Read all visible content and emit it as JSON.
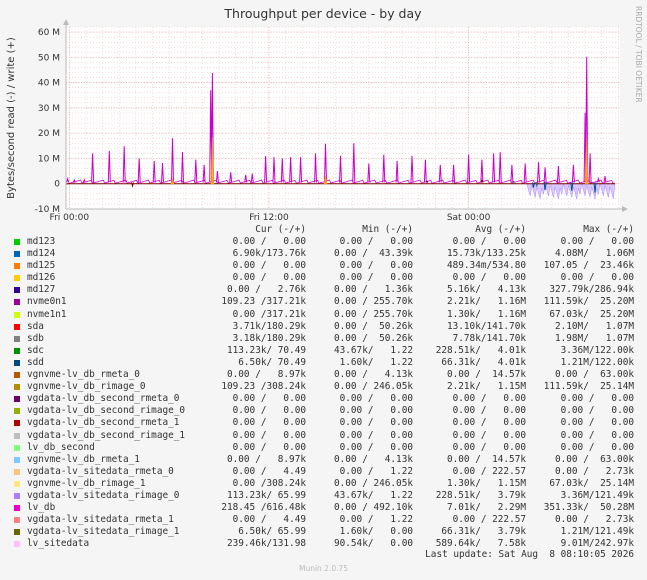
{
  "chart_data": {
    "type": "line",
    "title": "Throughput per device - by day",
    "ylabel": "Bytes/second read (-) / write (+)",
    "side_label": "RRDTOOL / TOBI OETIKER",
    "ylim": [
      -10000000,
      62000000
    ],
    "y_ticks": [
      {
        "v": -10000000,
        "label": "-10 M"
      },
      {
        "v": 0,
        "label": "0"
      },
      {
        "v": 10000000,
        "label": "10 M"
      },
      {
        "v": 20000000,
        "label": "20 M"
      },
      {
        "v": 30000000,
        "label": "30 M"
      },
      {
        "v": 40000000,
        "label": "40 M"
      },
      {
        "v": 50000000,
        "label": "50 M"
      },
      {
        "v": 60000000,
        "label": "60 M"
      }
    ],
    "x_ticks": [
      {
        "h": 0,
        "label": "Fri 00:00"
      },
      {
        "h": 12,
        "label": "Fri 12:00"
      },
      {
        "h": 24,
        "label": "Sat 00:00"
      }
    ],
    "xlim_hours": [
      -0.2,
      33.1
    ],
    "series": [
      {
        "name": "lv_db",
        "color": "#cc00cc",
        "spikes": [
          [
            -0.1,
            2.0
          ],
          [
            0.3,
            1.5
          ],
          [
            0.9,
            1.6
          ],
          [
            1.4,
            12.0
          ],
          [
            2.4,
            13.0
          ],
          [
            3.3,
            14.8
          ],
          [
            4.2,
            10.0
          ],
          [
            5.1,
            9.0
          ],
          [
            5.6,
            8.2
          ],
          [
            6.2,
            18.0
          ],
          [
            6.8,
            12.5
          ],
          [
            7.6,
            9.5
          ],
          [
            8.1,
            7.5
          ],
          [
            8.5,
            37.0
          ],
          [
            8.6,
            43.8
          ],
          [
            8.9,
            5.0
          ],
          [
            9.7,
            4.5
          ],
          [
            10.6,
            3.5
          ],
          [
            11.0,
            4.0
          ],
          [
            11.8,
            11.0
          ],
          [
            12.3,
            10.5
          ],
          [
            12.8,
            10.0
          ],
          [
            13.3,
            10.5
          ],
          [
            13.9,
            10.5
          ],
          [
            14.8,
            12.0
          ],
          [
            15.4,
            15.8
          ],
          [
            16.3,
            11.0
          ],
          [
            17.1,
            16.0
          ],
          [
            18.0,
            8.0
          ],
          [
            18.9,
            11.5
          ],
          [
            19.7,
            9.0
          ],
          [
            20.6,
            11.0
          ],
          [
            21.4,
            9.5
          ],
          [
            22.3,
            7.5
          ],
          [
            23.1,
            7.5
          ],
          [
            24.0,
            11.5
          ],
          [
            24.8,
            9.5
          ],
          [
            25.5,
            12.0
          ],
          [
            25.9,
            12.5
          ],
          [
            26.6,
            7.5
          ],
          [
            27.4,
            8.0
          ],
          [
            28.2,
            8.5
          ],
          [
            28.6,
            6.5
          ],
          [
            29.4,
            7.0
          ],
          [
            30.3,
            7.5
          ],
          [
            31.0,
            28.0
          ],
          [
            31.1,
            50.2
          ],
          [
            31.3,
            12.0
          ],
          [
            31.8,
            2.0
          ],
          [
            32.2,
            3.0
          ]
        ]
      },
      {
        "name": "nvme0n1",
        "color": "#ffa500",
        "spikes": [
          [
            8.6,
            18.5
          ],
          [
            31.1,
            18.5
          ],
          [
            6.2,
            2.0
          ],
          [
            15.4,
            3.0
          ]
        ]
      },
      {
        "name": "md127",
        "color": "#7f0000",
        "spikes": [
          [
            3.8,
            -0.9
          ],
          [
            21.5,
            0.9
          ],
          [
            24.8,
            1.3
          ]
        ]
      },
      {
        "name": "sdb",
        "color": "#555555",
        "spikes": [
          [
            26.7,
            0.9
          ],
          [
            28.1,
            -0.8
          ]
        ]
      },
      {
        "name": "sdd",
        "color": "#004d99",
        "spikes": [
          [
            27.9,
            -1.5
          ],
          [
            28.6,
            -2.5
          ],
          [
            30.2,
            -2.8
          ],
          [
            31.6,
            -3.5
          ]
        ]
      }
    ],
    "read_noise": {
      "color": "#aa88ff",
      "start_h": 27.5,
      "end_h": 32.8,
      "min": -6.0
    }
  },
  "legend": {
    "headers": {
      "cur": "Cur (-/+)",
      "min": "Min (-/+)",
      "avg": "Avg (-/+)",
      "max": "Max (-/+)"
    },
    "rows": [
      {
        "name": "md123",
        "color": "#00cc00",
        "cur": "0.00 /   0.00",
        "min": "0.00 /   0.00",
        "avg": "0.00 /   0.00",
        "max": "0.00 /   0.00"
      },
      {
        "name": "md124",
        "color": "#0066b3",
        "cur": "6.90k/173.76k",
        "min": "0.00 /  43.39k",
        "avg": "15.73k/133.25k",
        "max": "4.08M/   1.06M"
      },
      {
        "name": "md125",
        "color": "#ff8000",
        "cur": "0.00 /   0.00",
        "min": "0.00 /   0.00",
        "avg": "489.34m/534.80",
        "max": "107.05 /  23.46k"
      },
      {
        "name": "md126",
        "color": "#ffcc00",
        "cur": "0.00 /   0.00",
        "min": "0.00 /   0.00",
        "avg": "0.00 /   0.00",
        "max": "0.00 /   0.00"
      },
      {
        "name": "md127",
        "color": "#330099",
        "cur": "0.00 /   2.76k",
        "min": "0.00 /   1.36k",
        "avg": "5.16k/   4.13k",
        "max": "327.79k/286.94k"
      },
      {
        "name": "nvme0n1",
        "color": "#990099",
        "cur": "109.23 /317.21k",
        "min": "0.00 / 255.70k",
        "avg": "2.21k/   1.16M",
        "max": "111.59k/  25.20M"
      },
      {
        "name": "nvme1n1",
        "color": "#ccff00",
        "cur": "0.00 /317.21k",
        "min": "0.00 / 255.70k",
        "avg": "1.30k/   1.16M",
        "max": "67.03k/  25.20M"
      },
      {
        "name": "sda",
        "color": "#ff0000",
        "cur": "3.71k/180.29k",
        "min": "0.00 /  50.26k",
        "avg": "13.10k/141.70k",
        "max": "2.10M/   1.07M"
      },
      {
        "name": "sdb",
        "color": "#808080",
        "cur": "3.18k/180.29k",
        "min": "0.00 /  50.26k",
        "avg": "7.78k/141.70k",
        "max": "1.98M/   1.07M"
      },
      {
        "name": "sdc",
        "color": "#008f00",
        "cur": "113.23k/ 70.49",
        "min": "43.67k/   1.22",
        "avg": "228.51k/   4.01k",
        "max": "3.36M/122.00k"
      },
      {
        "name": "sdd",
        "color": "#00487d",
        "cur": "6.50k/ 70.49",
        "min": "1.60k/   1.22",
        "avg": "66.31k/   4.01k",
        "max": "1.21M/122.00k"
      },
      {
        "name": "vgnvme-lv_db_rmeta_0",
        "color": "#b35a00",
        "cur": "0.00 /   8.97k",
        "min": "0.00 /   4.13k",
        "avg": "0.00 /  14.57k",
        "max": "0.00 /  63.00k"
      },
      {
        "name": "vgnvme-lv_db_rimage_0",
        "color": "#b38f00",
        "cur": "109.23 /308.24k",
        "min": "0.00 / 246.05k",
        "avg": "2.21k/   1.15M",
        "max": "111.59k/  25.14M"
      },
      {
        "name": "vgdata-lv_db_second_rmeta_0",
        "color": "#6b006b",
        "cur": "0.00 /   0.00",
        "min": "0.00 /   0.00",
        "avg": "0.00 /   0.00",
        "max": "0.00 /   0.00"
      },
      {
        "name": "vgdata-lv_db_second_rimage_0",
        "color": "#8fb300",
        "cur": "0.00 /   0.00",
        "min": "0.00 /   0.00",
        "avg": "0.00 /   0.00",
        "max": "0.00 /   0.00"
      },
      {
        "name": "vgdata-lv_db_second_rmeta_1",
        "color": "#b30000",
        "cur": "0.00 /   0.00",
        "min": "0.00 /   0.00",
        "avg": "0.00 /   0.00",
        "max": "0.00 /   0.00"
      },
      {
        "name": "vgdata-lv_db_second_rimage_1",
        "color": "#bebebe",
        "cur": "0.00 /   0.00",
        "min": "0.00 /   0.00",
        "avg": "0.00 /   0.00",
        "max": "0.00 /   0.00"
      },
      {
        "name": "lv_db_second",
        "color": "#80ff80",
        "cur": "0.00 /   0.00",
        "min": "0.00 /   0.00",
        "avg": "0.00 /   0.00",
        "max": "0.00 /   0.00"
      },
      {
        "name": "vgnvme-lv_db_rmeta_1",
        "color": "#80c9ff",
        "cur": "0.00 /   8.97k",
        "min": "0.00 /   4.13k",
        "avg": "0.00 /  14.57k",
        "max": "0.00 /  63.00k"
      },
      {
        "name": "vgdata-lv_sitedata_rmeta_0",
        "color": "#ffc080",
        "cur": "0.00 /   4.49",
        "min": "0.00 /   1.22",
        "avg": "0.00 / 222.57",
        "max": "0.00 /   2.73k"
      },
      {
        "name": "vgnvme-lv_db_rimage_1",
        "color": "#ffe680",
        "cur": "0.00 /308.24k",
        "min": "0.00 / 246.05k",
        "avg": "1.30k/   1.15M",
        "max": "67.03k/  25.14M"
      },
      {
        "name": "vgdata-lv_sitedata_rimage_0",
        "color": "#aa80ff",
        "cur": "113.23k/ 65.99",
        "min": "43.67k/   1.22",
        "avg": "228.51k/   3.79k",
        "max": "3.36M/121.49k"
      },
      {
        "name": "lv_db",
        "color": "#ee00cc",
        "cur": "218.45 /616.48k",
        "min": "0.00 / 492.10k",
        "avg": "7.01k/   2.29M",
        "max": "351.33k/  50.28M"
      },
      {
        "name": "vgdata-lv_sitedata_rmeta_1",
        "color": "#ff8080",
        "cur": "0.00 /   4.49",
        "min": "0.00 /   1.22",
        "avg": "0.00 / 222.57",
        "max": "0.00 /   2.73k"
      },
      {
        "name": "vgdata-lv_sitedata_rimage_1",
        "color": "#666600",
        "cur": "6.50k/ 65.99",
        "min": "1.60k/   0.00",
        "avg": "66.31k/   3.79k",
        "max": "1.21M/121.49k"
      },
      {
        "name": "lv_sitedata",
        "color": "#ffbfff",
        "cur": "239.46k/131.98",
        "min": "90.54k/   0.00",
        "avg": "589.64k/   7.58k",
        "max": "9.01M/242.97k"
      }
    ],
    "last_update": "Last update: Sat Aug  8 08:10:05 2026"
  },
  "footer": "Munin 2.0.75"
}
